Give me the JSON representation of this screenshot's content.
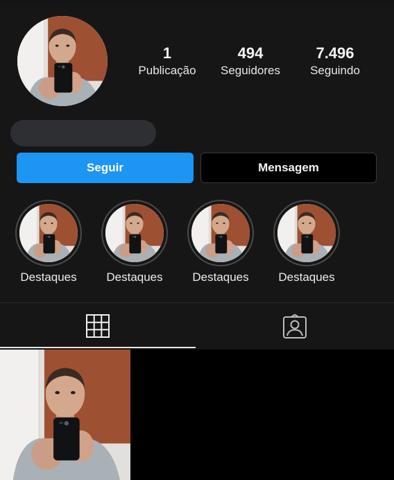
{
  "profile": {
    "stats": [
      {
        "value": "1",
        "label": "Publicação"
      },
      {
        "value": "494",
        "label": "Seguidores"
      },
      {
        "value": "7.496",
        "label": "Seguindo"
      }
    ]
  },
  "actions": {
    "follow_label": "Seguir",
    "message_label": "Mensagem"
  },
  "highlights": [
    {
      "label": "Destaques"
    },
    {
      "label": "Destaques"
    },
    {
      "label": "Destaques"
    },
    {
      "label": "Destaques"
    }
  ],
  "tabs": [
    {
      "icon": "grid-icon",
      "active": true
    },
    {
      "icon": "tagged-person-icon",
      "active": false
    }
  ],
  "colors": {
    "background": "#161616",
    "follow_button": "#1c95f3",
    "message_button": "#000000",
    "name_placeholder": "#2d2f33"
  }
}
